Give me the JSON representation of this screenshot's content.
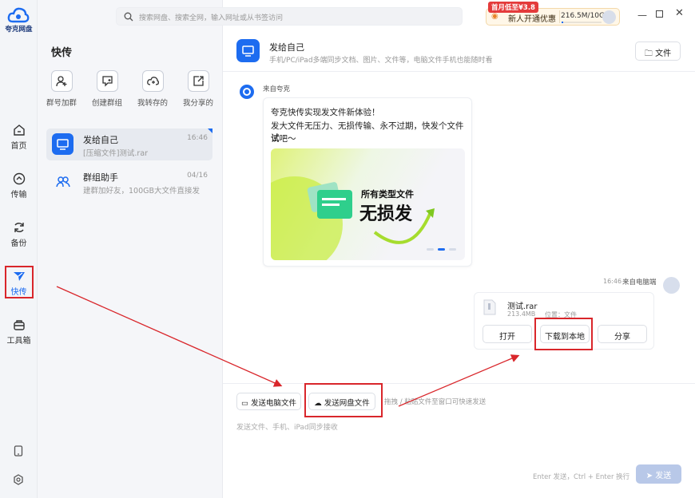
{
  "app": {
    "logo_label": "夸克网盘"
  },
  "search": {
    "placeholder": "搜索网盘、搜索全网，输入网址或从书签访问"
  },
  "header": {
    "promo_badge": "首月低至¥3.8",
    "promo_label": "新人开通优惠",
    "storage": "216.5M/10G"
  },
  "rail": {
    "items": [
      {
        "label": "首页",
        "icon": "home-icon"
      },
      {
        "label": "传输",
        "icon": "transfer-icon"
      },
      {
        "label": "备份",
        "icon": "backup-icon"
      },
      {
        "label": "快传",
        "icon": "quick-send-icon"
      },
      {
        "label": "工具箱",
        "icon": "toolbox-icon"
      }
    ]
  },
  "sidebar": {
    "title": "快传",
    "actions": [
      {
        "label": "群号加群",
        "icon": "join-group-icon"
      },
      {
        "label": "创建群组",
        "icon": "create-group-icon"
      },
      {
        "label": "我转存的",
        "icon": "saved-icon"
      },
      {
        "label": "我分享的",
        "icon": "shared-icon"
      }
    ],
    "conversations": [
      {
        "name": "发给自己",
        "time": "16:46",
        "preview": "[压缩文件]测试.rar"
      },
      {
        "name": "群组助手",
        "time": "04/16",
        "preview": "建群加好友，100GB大文件直接发"
      }
    ]
  },
  "chat": {
    "title": "发给自己",
    "subtitle": "手机/PC/iPad多端同步文档、图片、文件等，电脑文件手机也能随时看",
    "file_button": "文件",
    "msg1": {
      "sender": "来自夸克",
      "line1": "夸克快传实现发文件新体验！",
      "line2": "发大文件无压力、无损传输、永不过期，快发个文件试",
      "line3": "试吧～",
      "banner_small": "所有类型文件",
      "banner_big": "无损发"
    },
    "msg2": {
      "time": "16:46",
      "sender": "来自电脑端",
      "filename": "测试.rar",
      "meta": "213.4MB",
      "location": "位置：文件",
      "open": "打开",
      "download": "下载到本地",
      "share": "分享"
    }
  },
  "composer": {
    "send_pc_file": "发送电脑文件",
    "send_cloud_file": "发送网盘文件",
    "drag_hint": "拖拽 / 粘贴文件至窗口可快速发送",
    "placeholder": "发送文件、手机、iPad同步接收",
    "shortcut_hint": "Enter 发送，Ctrl + Enter 换行",
    "send_button": "发送"
  },
  "colors": {
    "accent": "#1d6cf0",
    "annotation_red": "#d9262b",
    "promo_orange": "#e8842a"
  }
}
